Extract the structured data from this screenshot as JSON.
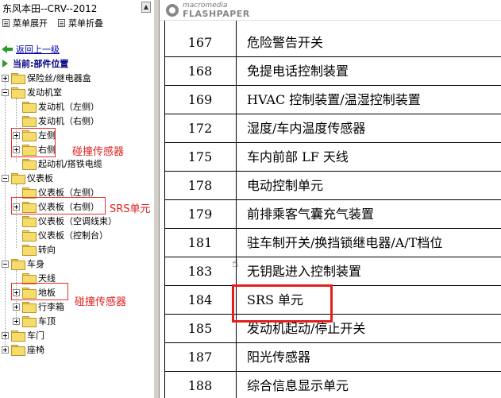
{
  "window": {
    "title": "东风本田--CRV--2012"
  },
  "menu": {
    "expand_label": "菜单展开",
    "collapse_label": "菜单折叠"
  },
  "nav": {
    "back_label": "返回上一级",
    "current_label": "当前:部件位置"
  },
  "tree": [
    {
      "label": "保险丝/继电器盒",
      "level": 0,
      "expander": "plus"
    },
    {
      "label": "发动机室",
      "level": 0,
      "expander": "minus"
    },
    {
      "label": "发动机（左侧）",
      "level": 1,
      "expander": "none"
    },
    {
      "label": "发动机（右侧）",
      "level": 1,
      "expander": "none"
    },
    {
      "label": "左侧",
      "level": 1,
      "expander": "plus"
    },
    {
      "label": "右侧",
      "level": 1,
      "expander": "plus"
    },
    {
      "label": "起动机/搭铁电缆",
      "level": 1,
      "expander": "none"
    },
    {
      "label": "仪表板",
      "level": 0,
      "expander": "minus"
    },
    {
      "label": "仪表板（左侧）",
      "level": 1,
      "expander": "none"
    },
    {
      "label": "仪表板（右侧）",
      "level": 1,
      "expander": "plus"
    },
    {
      "label": "仪表板（空调线束）",
      "level": 1,
      "expander": "none"
    },
    {
      "label": "仪表板（控制台）",
      "level": 1,
      "expander": "none"
    },
    {
      "label": "转向",
      "level": 1,
      "expander": "none"
    },
    {
      "label": "车身",
      "level": 0,
      "expander": "minus"
    },
    {
      "label": "天线",
      "level": 1,
      "expander": "none"
    },
    {
      "label": "地板",
      "level": 1,
      "expander": "plus"
    },
    {
      "label": "行李箱",
      "level": 1,
      "expander": "plus"
    },
    {
      "label": "车顶",
      "level": 1,
      "expander": "plus"
    },
    {
      "label": "车门",
      "level": 0,
      "expander": "plus"
    },
    {
      "label": "座椅",
      "level": 0,
      "expander": "plus"
    }
  ],
  "annotations": {
    "collision_sensor_1": "碰撞传感器",
    "srs_unit": "SRS单元",
    "collision_sensor_2": "碰撞传感器"
  },
  "viewer": {
    "brand_small": "macromedia",
    "brand": "FLASHPAPER"
  },
  "document_rows": [
    {
      "code": "167",
      "name": "危险警告开关"
    },
    {
      "code": "168",
      "name": "免提电话控制装置"
    },
    {
      "code": "169",
      "name": "HVAC 控制装置/温湿控制装置"
    },
    {
      "code": "172",
      "name": "湿度/车内温度传感器"
    },
    {
      "code": "175",
      "name": "车内前部 LF 天线"
    },
    {
      "code": "178",
      "name": "电动控制单元"
    },
    {
      "code": "179",
      "name": "前排乘客气囊充气装置"
    },
    {
      "code": "181",
      "name": "驻车制开关/换挡锁继电器/A/T档位"
    },
    {
      "code": "183",
      "name": "无钥匙进入控制装置"
    },
    {
      "code": "184",
      "name": "SRS 单元"
    },
    {
      "code": "185",
      "name": "发动机起动/停止开关"
    },
    {
      "code": "187",
      "name": "阳光传感器"
    },
    {
      "code": "188",
      "name": "综合信息显示单元"
    }
  ],
  "colors": {
    "annotation_red": "#e02020",
    "folder_yellow": "#f6dc6b",
    "link_blue": "#0000aa"
  }
}
